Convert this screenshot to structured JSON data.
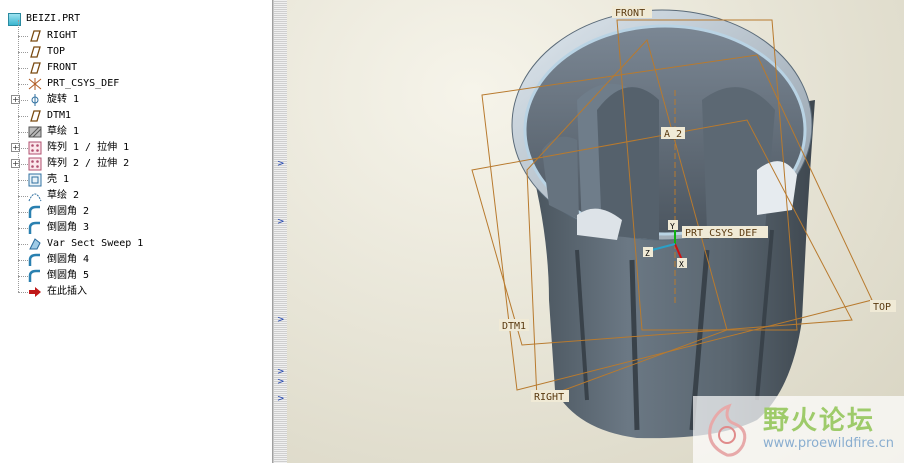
{
  "tree": {
    "root": {
      "label": "BEIZI.PRT",
      "icon": "part-icon"
    },
    "items": [
      {
        "label": "RIGHT",
        "icon": "datum-plane-icon",
        "expandable": false
      },
      {
        "label": "TOP",
        "icon": "datum-plane-icon",
        "expandable": false
      },
      {
        "label": "FRONT",
        "icon": "datum-plane-icon",
        "expandable": false
      },
      {
        "label": "PRT_CSYS_DEF",
        "icon": "csys-icon",
        "expandable": false
      },
      {
        "label": "旋转 1",
        "icon": "revolve-icon",
        "expandable": true
      },
      {
        "label": "DTM1",
        "icon": "datum-plane-icon",
        "expandable": false
      },
      {
        "label": "草绘 1",
        "icon": "sketch-hatched-icon",
        "expandable": false
      },
      {
        "label": "阵列 1 / 拉伸 1",
        "icon": "pattern-icon",
        "expandable": true
      },
      {
        "label": "阵列 2 / 拉伸 2",
        "icon": "pattern-icon",
        "expandable": true
      },
      {
        "label": "壳 1",
        "icon": "shell-icon",
        "expandable": false
      },
      {
        "label": "草绘 2",
        "icon": "sketch-curve-icon",
        "expandable": false
      },
      {
        "label": "倒圆角 2",
        "icon": "round-icon",
        "expandable": false
      },
      {
        "label": "倒圆角 3",
        "icon": "round-icon",
        "expandable": false
      },
      {
        "label": "Var Sect Sweep 1",
        "icon": "sweep-icon",
        "expandable": false
      },
      {
        "label": "倒圆角 4",
        "icon": "round-icon",
        "expandable": false
      },
      {
        "label": "倒圆角 5",
        "icon": "round-icon",
        "expandable": false
      },
      {
        "label": "在此插入",
        "icon": "insert-here-arrow-icon",
        "expandable": false
      }
    ]
  },
  "viewport": {
    "labels": {
      "front": "FRONT",
      "top": "TOP",
      "right": "RIGHT",
      "dtm1": "DTM1",
      "axis": "A_2",
      "csys": "PRT_CSYS_DEF",
      "x": "X",
      "y": "Y",
      "z": "Z"
    },
    "colors": {
      "datum": "#b87a2e",
      "model": "#5d6b77",
      "axis_x": "#d01010",
      "axis_y": "#10b010",
      "axis_z": "#2aa0c8"
    }
  },
  "watermark": {
    "title": "野火论坛",
    "url": "www.proewildfire.cn"
  }
}
